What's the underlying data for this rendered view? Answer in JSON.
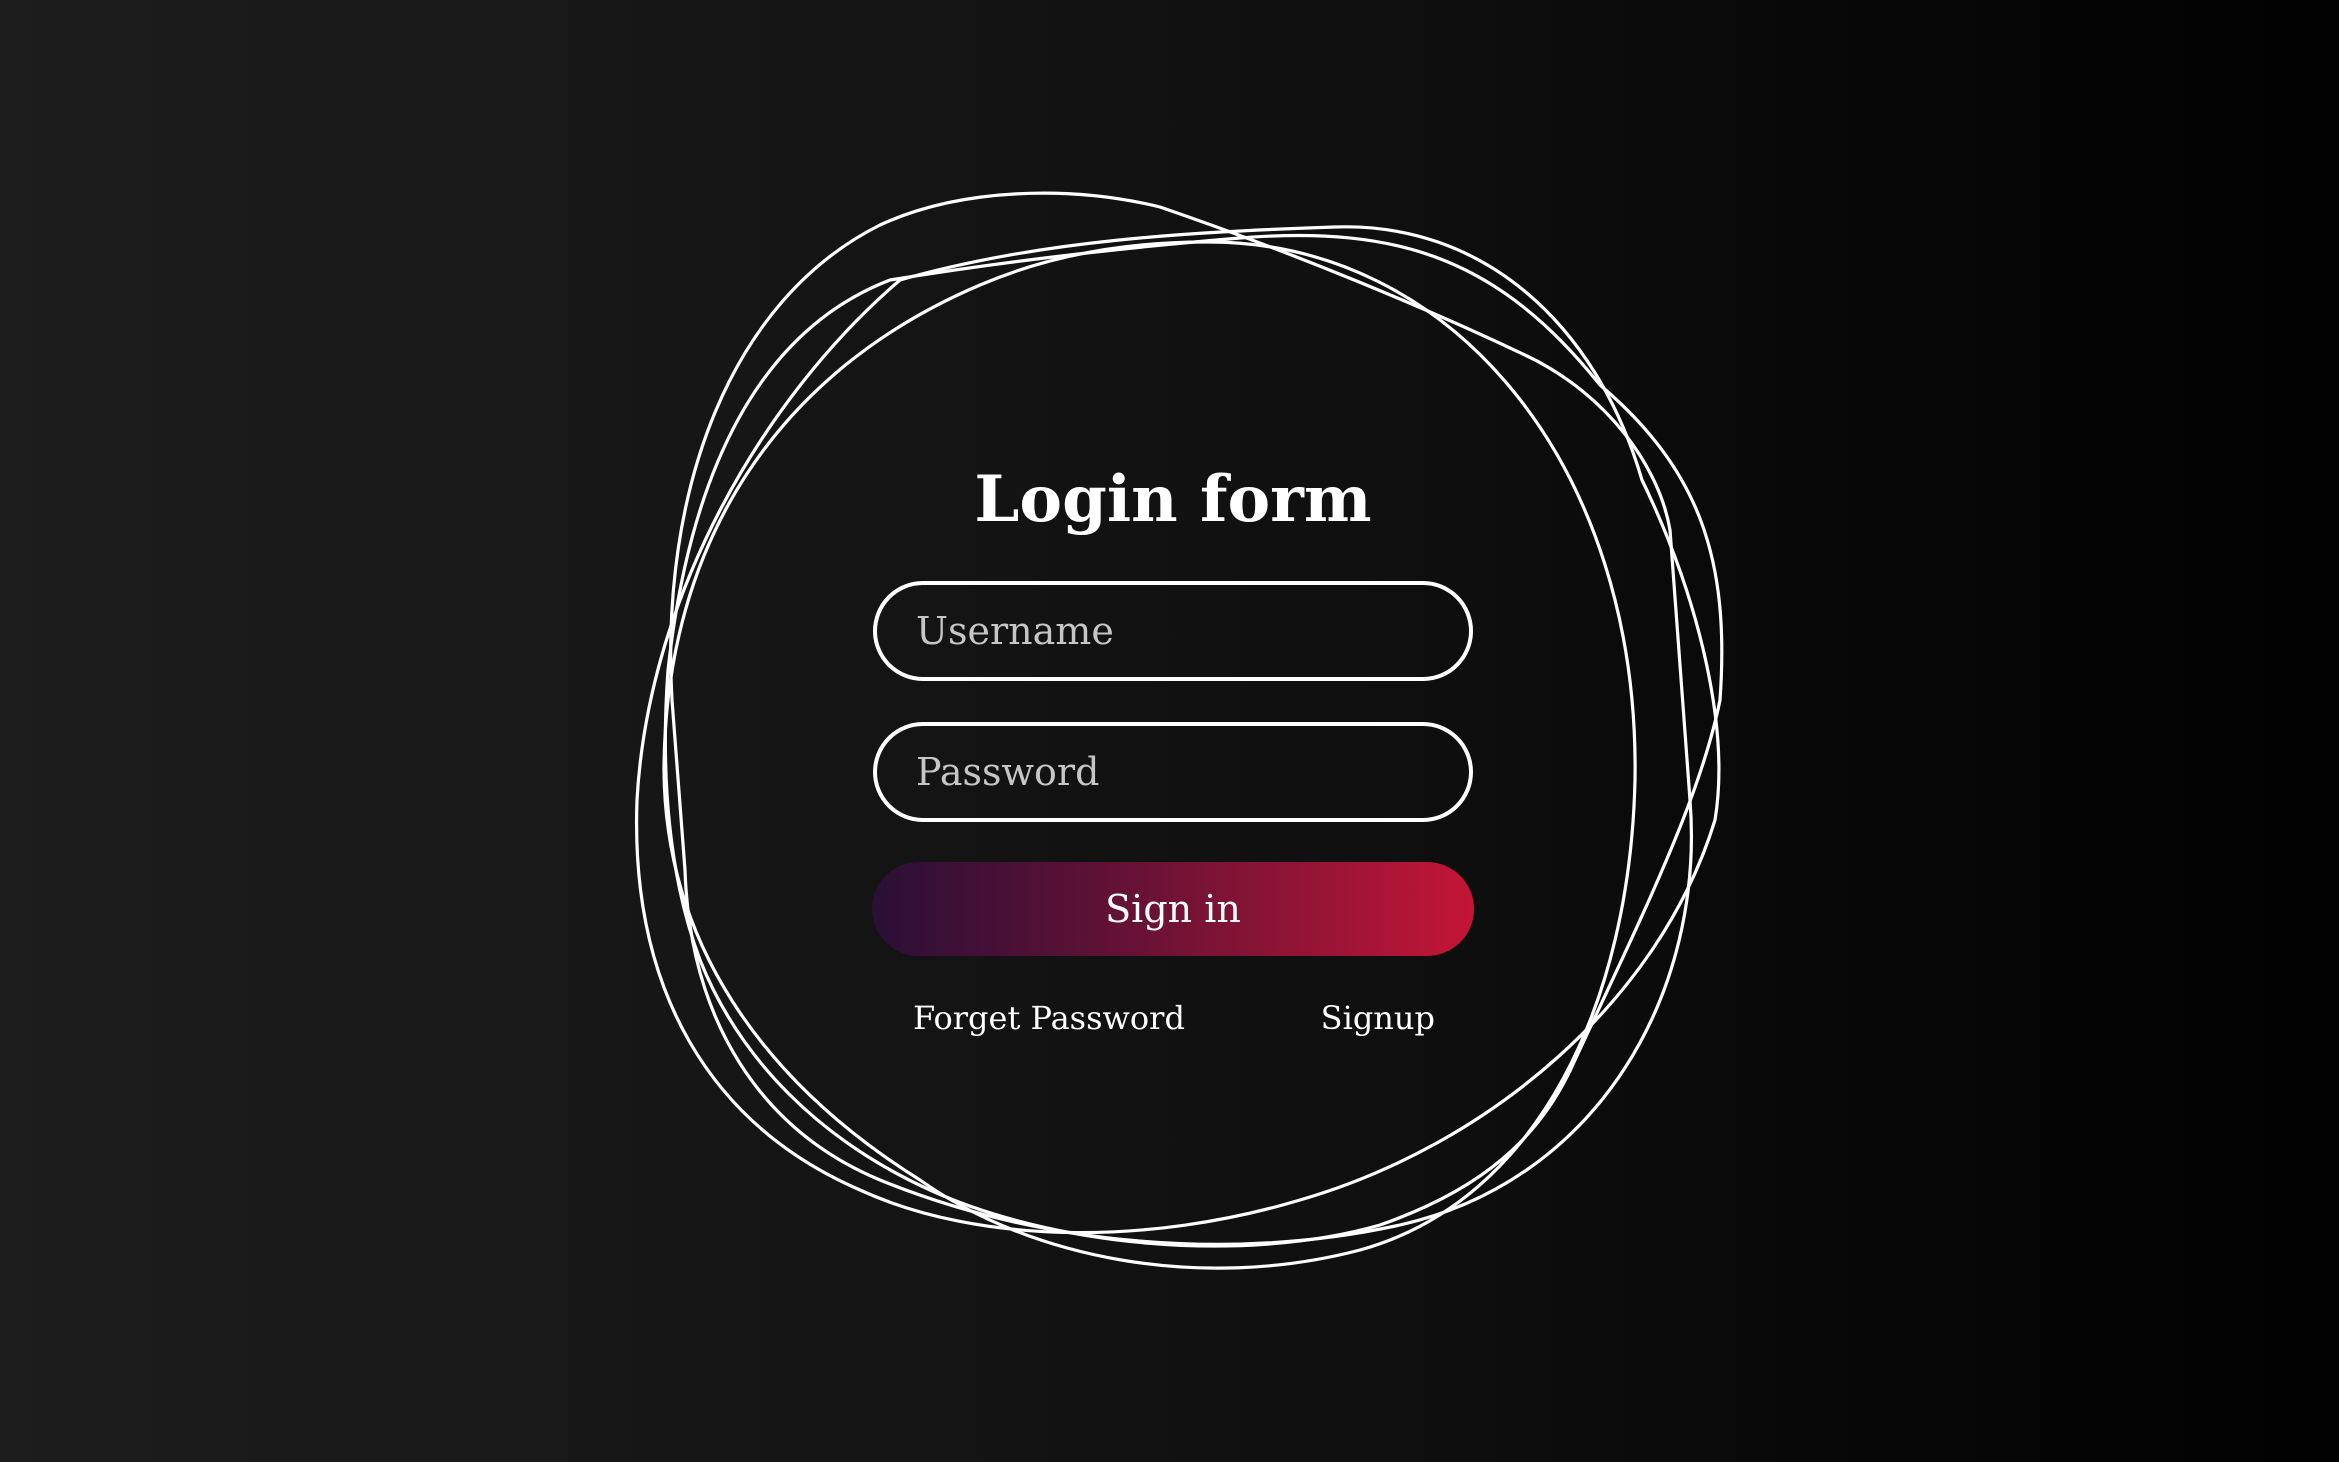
{
  "login": {
    "title": "Login form",
    "username_placeholder": "Username",
    "password_placeholder": "Password",
    "signin_label": "Sign in",
    "forget_password_label": "Forget Password",
    "signup_label": "Signup"
  },
  "colors": {
    "background": "#0f0f0f",
    "ring_stroke": "#ffffff",
    "button_gradient_start": "#2a0f36",
    "button_gradient_end": "#c41536"
  }
}
